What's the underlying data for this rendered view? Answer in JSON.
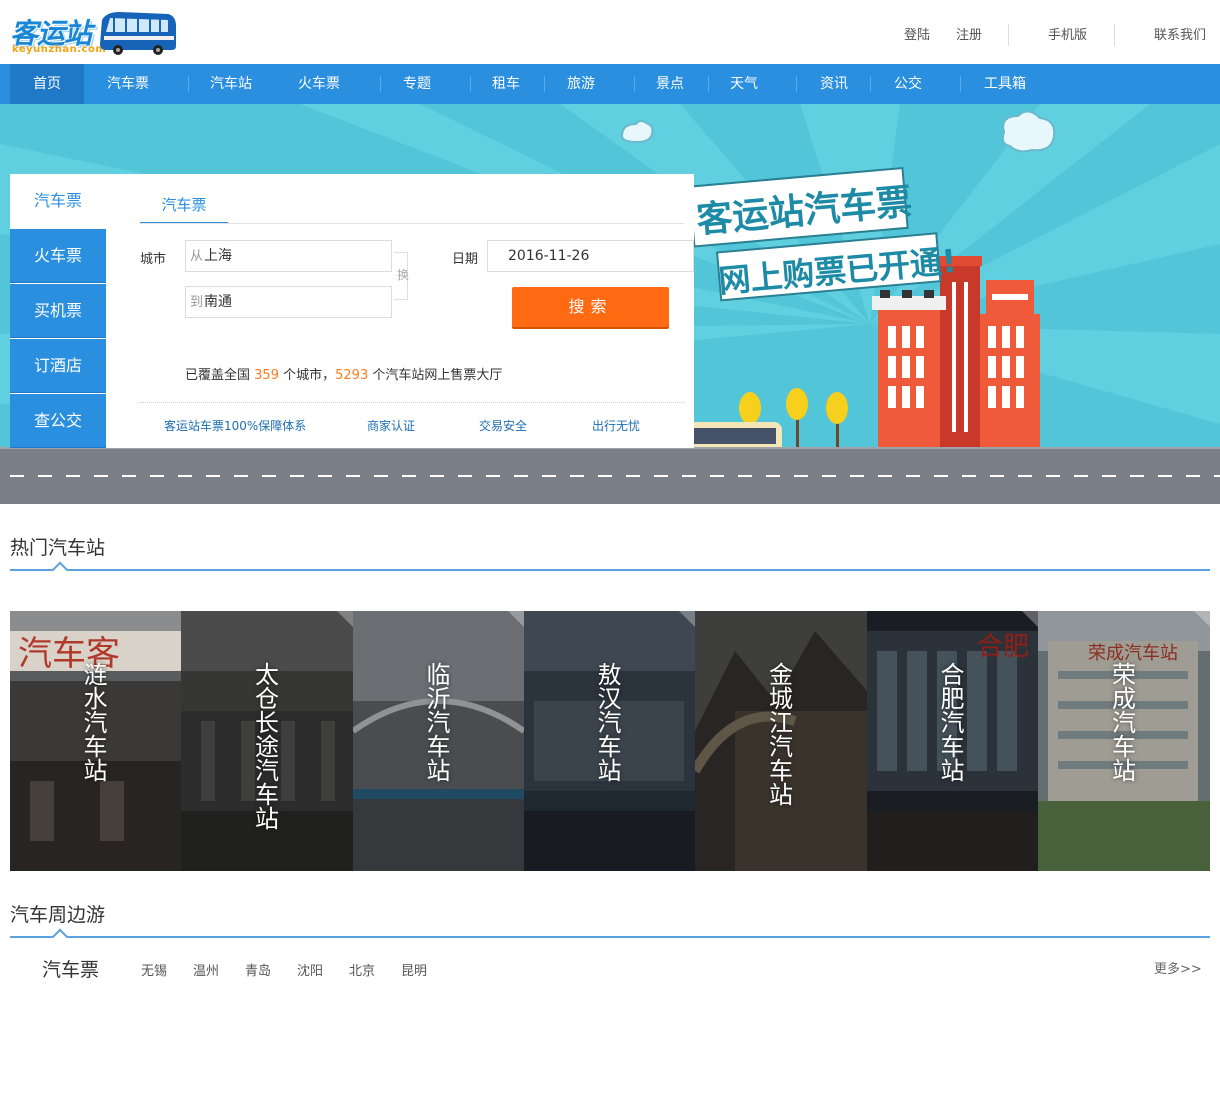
{
  "logo": {
    "text": "客运站",
    "sub": "keyunzhan.com"
  },
  "top_links": {
    "login": "登陆",
    "register": "注册",
    "mobile": "手机版",
    "contact": "联系我们"
  },
  "nav": {
    "items": [
      {
        "label": "首页",
        "active": true
      },
      {
        "label": "汽车票"
      },
      {
        "label": "汽车站"
      },
      {
        "label": "火车票"
      },
      {
        "label": "专题"
      },
      {
        "label": "租车"
      },
      {
        "label": "旅游"
      },
      {
        "label": "景点"
      },
      {
        "label": "天气"
      },
      {
        "label": "资讯"
      },
      {
        "label": "公交"
      },
      {
        "label": "工具箱"
      }
    ]
  },
  "banner": {
    "line1": "客运站汽车票",
    "line2": "网上购票已开通!"
  },
  "search": {
    "side_tabs": [
      {
        "label": "汽车票",
        "active": true
      },
      {
        "label": "火车票"
      },
      {
        "label": "买机票"
      },
      {
        "label": "订酒店"
      },
      {
        "label": "查公交"
      }
    ],
    "tab_label": "汽车票",
    "city_label": "城市",
    "date_label": "日期",
    "from_prefix": "从",
    "from_value": "上海",
    "to_prefix": "到",
    "to_value": "南通",
    "swap_label": "换",
    "date_value": "2016-11-26",
    "button_label": "搜索",
    "coverage": {
      "pre": "已覆盖全国",
      "cities": "359",
      "mid": "个城市，",
      "stations": "5293",
      "post": "个汽车站网上售票大厅"
    },
    "guarantees": [
      "客运站车票100%保障体系",
      "商家认证",
      "交易安全",
      "出行无忧"
    ]
  },
  "hot_stations": {
    "title": "热门汽车站",
    "items": [
      {
        "name": "涟水汽车站"
      },
      {
        "name": "太仓长途汽车站"
      },
      {
        "name": "临沂汽车站"
      },
      {
        "name": "敖汉汽车站"
      },
      {
        "name": "金城江汽车站"
      },
      {
        "name": "合肥汽车站"
      },
      {
        "name": "荣成汽车站"
      }
    ]
  },
  "nearby": {
    "title": "汽车周边游",
    "tab": "汽车票",
    "cities": [
      "无锡",
      "温州",
      "青岛",
      "沈阳",
      "北京",
      "昆明"
    ],
    "more": "更多>>"
  },
  "colors": {
    "accent": "#2b8fe0",
    "orange": "#ff6a13",
    "banner": "#52c6d8"
  }
}
